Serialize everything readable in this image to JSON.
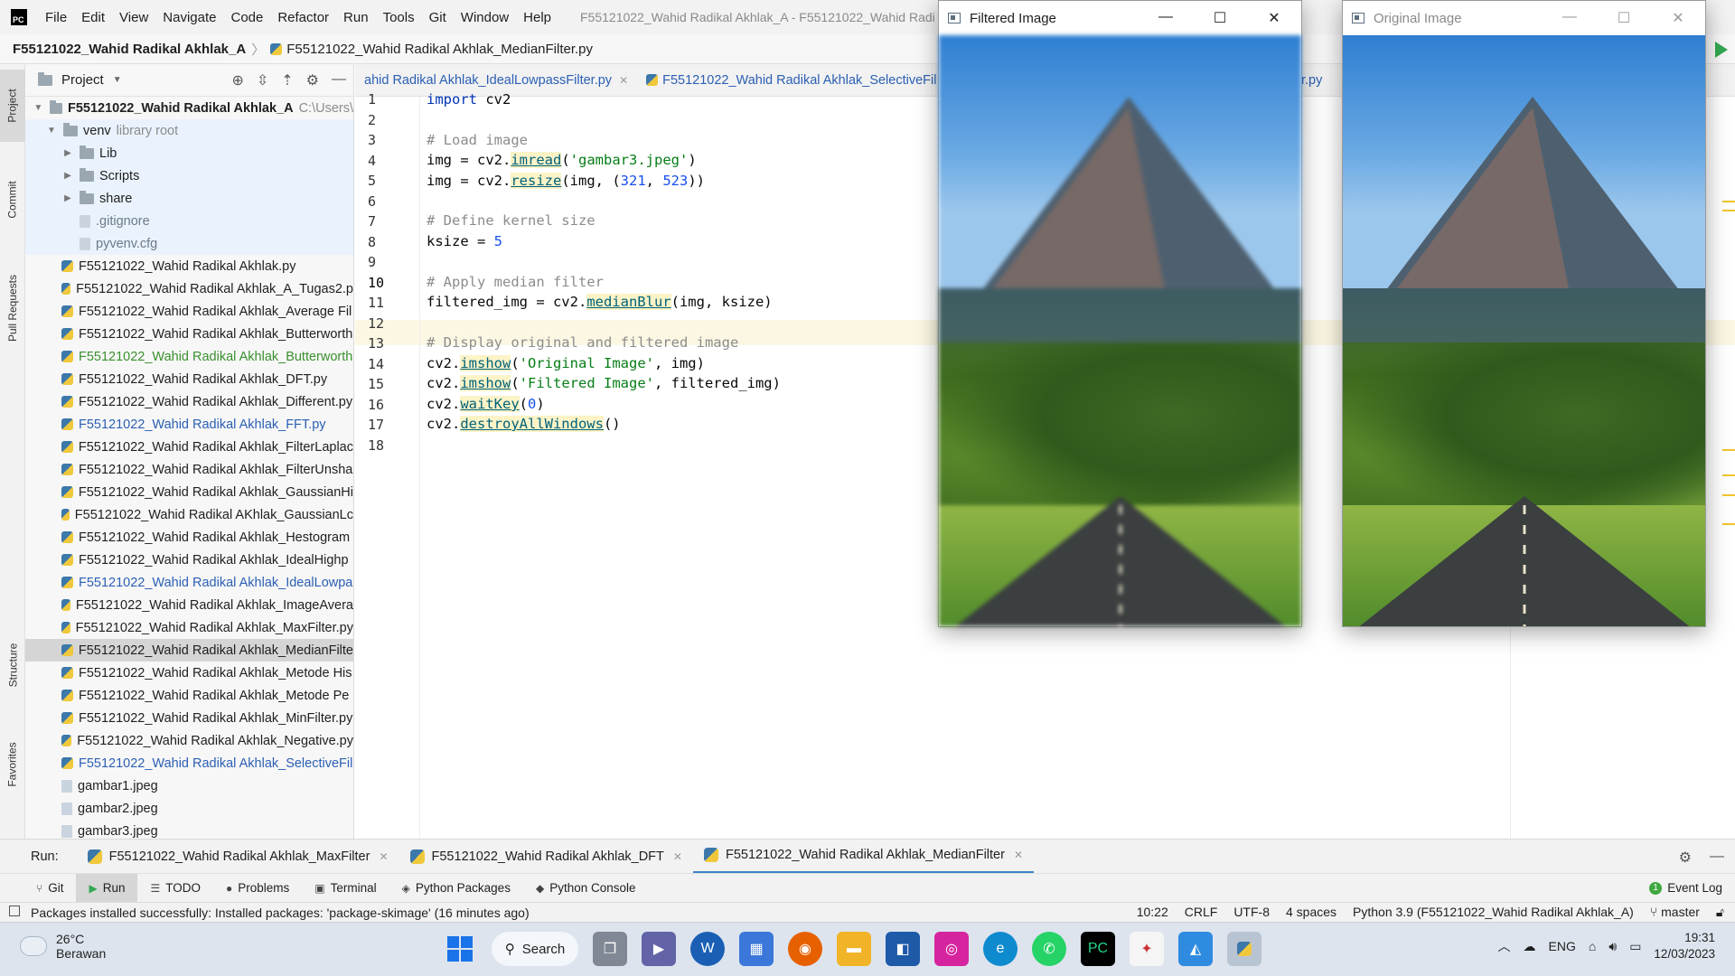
{
  "menubar": {
    "items": [
      "File",
      "Edit",
      "View",
      "Navigate",
      "Code",
      "Refactor",
      "Run",
      "Tools",
      "Git",
      "Window",
      "Help"
    ],
    "window_title": "F55121022_Wahid Radikal Akhlak_A - F55121022_Wahid Radi"
  },
  "navbar": {
    "root": "F55121022_Wahid Radikal Akhlak_A",
    "file": "F55121022_Wahid Radikal Akhlak_MedianFilter.py"
  },
  "left_stripe": {
    "project": "Project",
    "commit": "Commit",
    "pull_requests": "Pull Requests",
    "structure": "Structure",
    "favorites": "Favorites"
  },
  "project_panel": {
    "header": "Project",
    "root_name": "F55121022_Wahid Radikal Akhlak_A",
    "root_path": "C:\\Users\\",
    "venv_name": "venv",
    "venv_hint": "library root",
    "venv_children": [
      "Lib",
      "Scripts",
      "share"
    ],
    "venv_files": [
      ".gitignore",
      "pyvenv.cfg"
    ],
    "files": [
      {
        "name": "F55121022_Wahid Radikal Akhlak.py",
        "style": "normal"
      },
      {
        "name": "F55121022_Wahid Radikal Akhlak_A_Tugas2.p",
        "style": "normal"
      },
      {
        "name": "F55121022_Wahid Radikal Akhlak_Average Fil",
        "style": "normal"
      },
      {
        "name": "F55121022_Wahid Radikal Akhlak_Butterworth",
        "style": "normal"
      },
      {
        "name": "F55121022_Wahid Radikal Akhlak_Butterworth",
        "style": "green"
      },
      {
        "name": "F55121022_Wahid Radikal Akhlak_DFT.py",
        "style": "normal"
      },
      {
        "name": "F55121022_Wahid Radikal Akhlak_Different.py",
        "style": "normal"
      },
      {
        "name": "F55121022_Wahid Radikal Akhlak_FFT.py",
        "style": "blue"
      },
      {
        "name": "F55121022_Wahid Radikal Akhlak_FilterLaplac",
        "style": "normal"
      },
      {
        "name": "F55121022_Wahid Radikal Akhlak_FilterUnsha",
        "style": "normal"
      },
      {
        "name": "F55121022_Wahid Radikal Akhlak_GaussianHi",
        "style": "normal"
      },
      {
        "name": "F55121022_Wahid Radikal AKhlak_GaussianLc",
        "style": "normal"
      },
      {
        "name": "F55121022_Wahid Radikal Akhlak_Hestogram",
        "style": "normal"
      },
      {
        "name": "F55121022_Wahid Radikal Akhlak_IdealHighp",
        "style": "normal"
      },
      {
        "name": "F55121022_Wahid Radikal Akhlak_IdealLowpa",
        "style": "blue"
      },
      {
        "name": "F55121022_Wahid Radikal Akhlak_ImageAvera",
        "style": "normal"
      },
      {
        "name": "F55121022_Wahid Radikal Akhlak_MaxFilter.py",
        "style": "normal"
      },
      {
        "name": "F55121022_Wahid Radikal Akhlak_MedianFilte",
        "style": "selected"
      },
      {
        "name": "F55121022_Wahid Radikal Akhlak_Metode His",
        "style": "normal"
      },
      {
        "name": "F55121022_Wahid Radikal Akhlak_Metode Pe",
        "style": "normal"
      },
      {
        "name": "F55121022_Wahid Radikal Akhlak_MinFilter.py",
        "style": "normal"
      },
      {
        "name": "F55121022_Wahid Radikal Akhlak_Negative.py",
        "style": "normal"
      },
      {
        "name": "F55121022_Wahid Radikal Akhlak_SelectiveFil",
        "style": "blue"
      },
      {
        "name": "gambar1.jpeg",
        "style": "normal"
      },
      {
        "name": "gambar2.jpeg",
        "style": "normal"
      },
      {
        "name": "gambar3.jpeg",
        "style": "normal"
      }
    ]
  },
  "editor_tabs": {
    "tab1": "ahid Radikal Akhlak_IdealLowpassFilter.py",
    "tab2": "F55121022_Wahid Radikal Akhlak_SelectiveFil",
    "tab3": "r.py"
  },
  "editor": {
    "current_line": 10,
    "lines": [
      {
        "n": "1"
      },
      {
        "n": "2"
      },
      {
        "n": "3"
      },
      {
        "n": "4"
      },
      {
        "n": "5"
      },
      {
        "n": "6"
      },
      {
        "n": "7"
      },
      {
        "n": "8"
      },
      {
        "n": "9"
      },
      {
        "n": "10"
      },
      {
        "n": "11"
      },
      {
        "n": "12"
      },
      {
        "n": "13"
      },
      {
        "n": "14"
      },
      {
        "n": "15"
      },
      {
        "n": "16"
      },
      {
        "n": "17"
      },
      {
        "n": "18"
      }
    ],
    "code": {
      "l1_kw": "import",
      "l1_rest": " cv2",
      "l3": "# Load image",
      "l4_a": "img = cv2.",
      "l4_fn": "imread",
      "l4_b": "(",
      "l4_str": "'gambar3.jpeg'",
      "l4_c": ")",
      "l5_a": "img = cv2.",
      "l5_fn": "resize",
      "l5_b": "(img, (",
      "l5_n1": "321",
      "l5_c": ", ",
      "l5_n2": "523",
      "l5_d": "))",
      "l7": "# Define kernel size",
      "l8_a": "ksize = ",
      "l8_n": "5",
      "l10": "# Apply median filter",
      "l11_a": "filtered_img = cv2.",
      "l11_fn": "medianBlur",
      "l11_b": "(img, ksize)",
      "l13": "# Display original and filtered image",
      "l14_a": "cv2.",
      "l14_fn": "imshow",
      "l14_b": "(",
      "l14_str": "'Original Image'",
      "l14_c": ", img)",
      "l15_a": "cv2.",
      "l15_fn": "imshow",
      "l15_b": "(",
      "l15_str": "'Filtered Image'",
      "l15_c": ", filtered_img)",
      "l16_a": "cv2.",
      "l16_fn": "waitKey",
      "l16_b": "(",
      "l16_n": "0",
      "l16_c": ")",
      "l17_a": "cv2.",
      "l17_fn": "destroyAllWindows",
      "l17_b": "()"
    }
  },
  "filtered_window": {
    "title": "Filtered Image"
  },
  "original_window": {
    "title": "Original Image"
  },
  "run_bar": {
    "label": "Run:",
    "tabs": [
      "F55121022_Wahid Radikal Akhlak_MaxFilter",
      "F55121022_Wahid Radikal Akhlak_DFT",
      "F55121022_Wahid Radikal Akhlak_MedianFilter"
    ]
  },
  "tool_tabs": {
    "git": "Git",
    "run": "Run",
    "todo": "TODO",
    "problems": "Problems",
    "terminal": "Terminal",
    "python_packages": "Python Packages",
    "python_console": "Python Console",
    "event_log": "Event Log",
    "event_count": "1"
  },
  "status_bar": {
    "message": "Packages installed successfully: Installed packages: 'package-skimage' (16 minutes ago)",
    "position": "10:22",
    "line_sep": "CRLF",
    "encoding": "UTF-8",
    "indent": "4 spaces",
    "interpreter": "Python 3.9 (F55121022_Wahid Radikal Akhlak_A)",
    "branch": "master"
  },
  "taskbar": {
    "temp": "26°C",
    "weather": "Berawan",
    "search": "Search",
    "lang": "ENG",
    "time": "19:31",
    "date": "12/03/2023"
  },
  "colors": {
    "accent": "#4083c9",
    "keyword": "#0033b3",
    "string": "#067d17",
    "number": "#1750eb",
    "comment": "#8c8c8c",
    "current_line": "#fcf7e3"
  }
}
